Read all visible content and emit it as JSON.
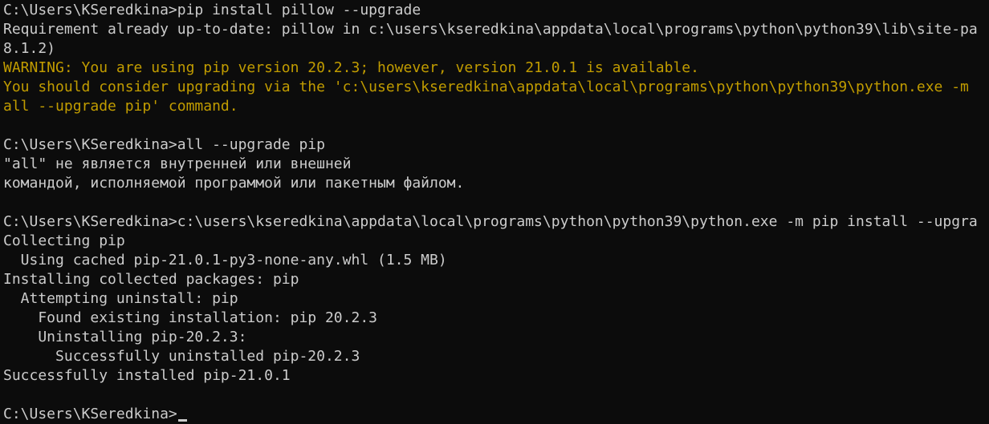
{
  "terminal": {
    "lines": [
      {
        "text": "C:\\Users\\KSeredkina>pip install pillow --upgrade",
        "type": "prompt-command"
      },
      {
        "text": "Requirement already up-to-date: pillow in c:\\users\\kseredkina\\appdata\\local\\programs\\python\\python39\\lib\\site-pa",
        "type": "output"
      },
      {
        "text": "8.1.2)",
        "type": "output"
      },
      {
        "text": "WARNING: You are using pip version 20.2.3; however, version 21.0.1 is available.",
        "type": "warning"
      },
      {
        "text": "You should consider upgrading via the 'c:\\users\\kseredkina\\appdata\\local\\programs\\python\\python39\\python.exe -m",
        "type": "warning"
      },
      {
        "text": "all --upgrade pip' command.",
        "type": "warning"
      },
      {
        "text": "",
        "type": "blank"
      },
      {
        "text": "C:\\Users\\KSeredkina>all --upgrade pip",
        "type": "prompt-command"
      },
      {
        "text": "\"all\" не является внутренней или внешней",
        "type": "output"
      },
      {
        "text": "командой, исполняемой программой или пакетным файлом.",
        "type": "output"
      },
      {
        "text": "",
        "type": "blank"
      },
      {
        "text": "C:\\Users\\KSeredkina>c:\\users\\kseredkina\\appdata\\local\\programs\\python\\python39\\python.exe -m pip install --upgra",
        "type": "prompt-command"
      },
      {
        "text": "Collecting pip",
        "type": "output"
      },
      {
        "text": "  Using cached pip-21.0.1-py3-none-any.whl (1.5 MB)",
        "type": "output"
      },
      {
        "text": "Installing collected packages: pip",
        "type": "output"
      },
      {
        "text": "  Attempting uninstall: pip",
        "type": "output"
      },
      {
        "text": "    Found existing installation: pip 20.2.3",
        "type": "output"
      },
      {
        "text": "    Uninstalling pip-20.2.3:",
        "type": "output"
      },
      {
        "text": "      Successfully uninstalled pip-20.2.3",
        "type": "output"
      },
      {
        "text": "Successfully installed pip-21.0.1",
        "type": "output"
      },
      {
        "text": "",
        "type": "blank"
      },
      {
        "text": "C:\\Users\\KSeredkina>",
        "type": "prompt-current"
      }
    ]
  },
  "colors": {
    "background": "#0c0c0c",
    "text": "#cccccc",
    "warning": "#c19c00"
  }
}
